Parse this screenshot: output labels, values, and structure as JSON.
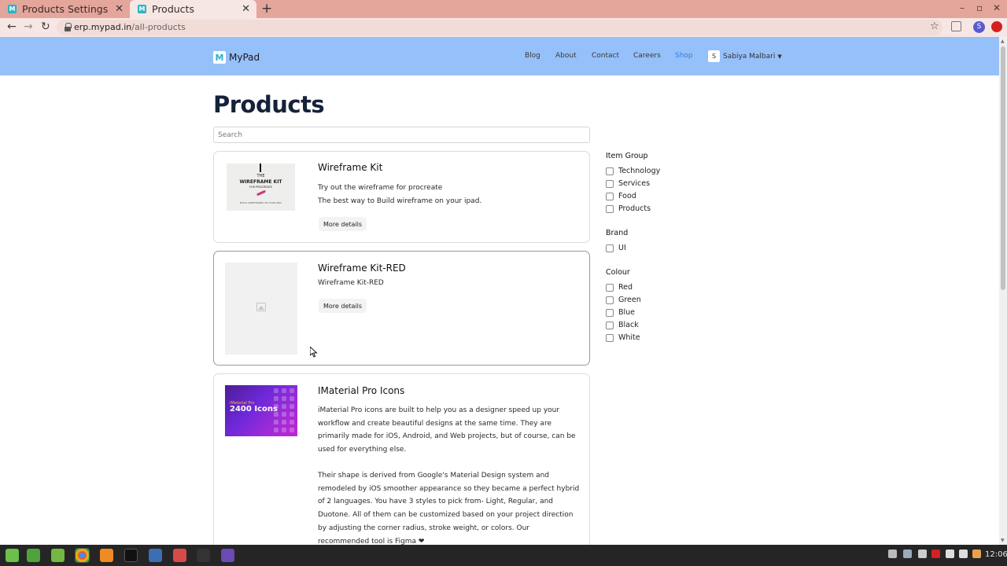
{
  "browser": {
    "tabs": [
      {
        "title": "Products Settings",
        "icon": "site-favicon"
      },
      {
        "title": "Products",
        "icon": "site-favicon"
      }
    ],
    "address": {
      "host": "erp.mypad.in",
      "path": "/all-products"
    },
    "profile_initial": "S"
  },
  "site": {
    "logo_text": "MyPad",
    "nav": [
      "Blog",
      "About",
      "Contact",
      "Careers",
      "Shop"
    ],
    "active_nav": "Shop",
    "user": {
      "initial": "S",
      "name": "Sabiya Malbari"
    }
  },
  "page": {
    "title": "Products",
    "search_placeholder": "Search"
  },
  "products": [
    {
      "name": "Wireframe Kit",
      "description": [
        "Try out the wireframe for procreate",
        "The best way to Build wireframe on your ipad."
      ],
      "image_text": {
        "line1": "THE",
        "line2": "WIREFRAME KIT",
        "line3": "FOR PROCREATE",
        "line4": "BUILD WIREFRAMES ON YOUR IPAD"
      },
      "button": "More details"
    },
    {
      "name": "Wireframe Kit-RED",
      "description": [
        "Wireframe Kit-RED"
      ],
      "button": "More details"
    },
    {
      "name": "IMaterial Pro Icons",
      "image_text": {
        "small": "IMaterial Pro",
        "big": "2400 Icons"
      },
      "description_paragraphs": [
        "iMaterial Pro icons are built to help you as a designer speed up your workflow and create beautiful designs at the same time. They are primarily made for iOS, Android, and Web projects, but of course, can be used for everything else.",
        "Their shape is derived from Google's Material Design system and remodeled by iOS smoother appearance so they became a perfect hybrid of 2 languages. You have 3 styles to pick from- Light, Regular, and Duotone. All of them can be customized based on your project direction by adjusting the corner radius, stroke weight, or colors. Our recommended tool is Figma ❤"
      ]
    }
  ],
  "filters": [
    {
      "heading": "Item Group",
      "options": [
        "Technology",
        "Services",
        "Food",
        "Products"
      ]
    },
    {
      "heading": "Brand",
      "options": [
        "UI"
      ]
    },
    {
      "heading": "Colour",
      "options": [
        "Red",
        "Green",
        "Blue",
        "Black",
        "White"
      ]
    }
  ],
  "taskbar": {
    "clock": "12:06"
  },
  "colors": {
    "navbar": "#96c0f9",
    "tabbar": "#e4a59b",
    "active_nav": "#2f7fe0",
    "accent_logo": "#26b4c4"
  }
}
